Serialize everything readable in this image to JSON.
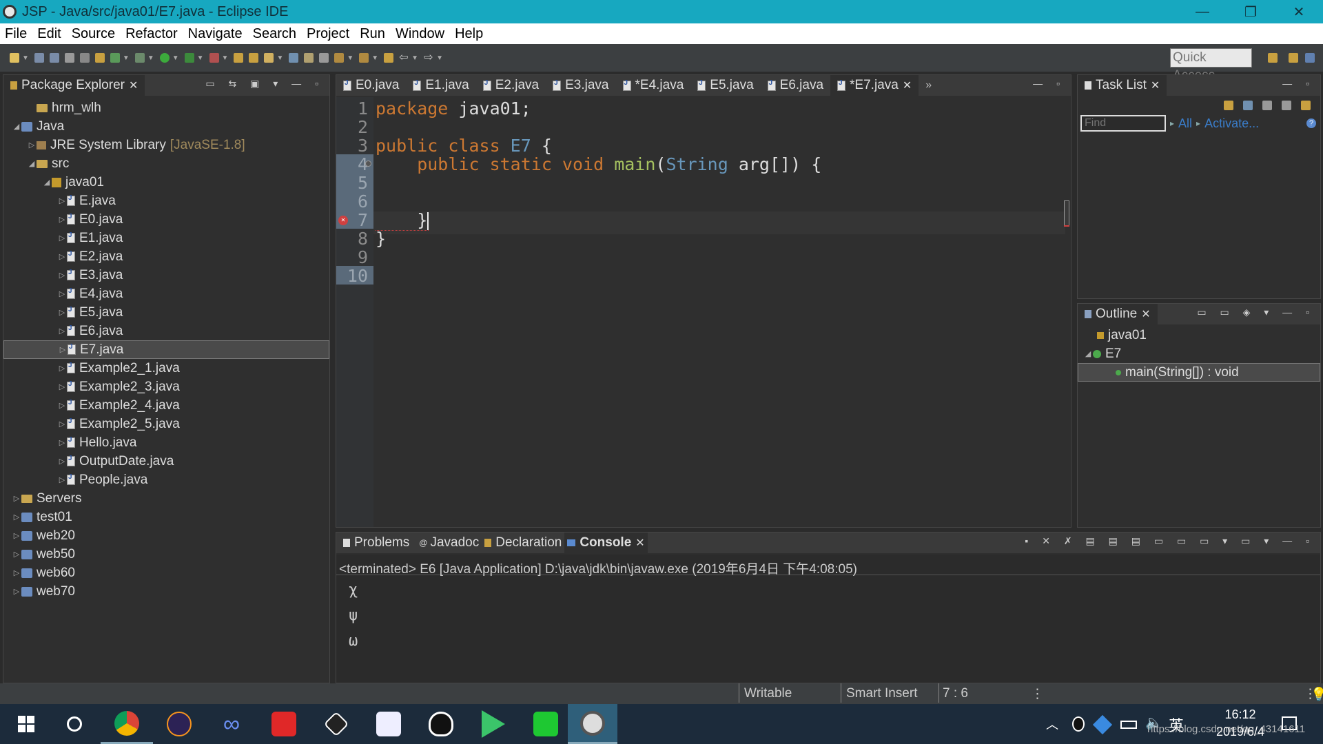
{
  "window": {
    "title": "JSP - Java/src/java01/E7.java - Eclipse IDE"
  },
  "menu": [
    "File",
    "Edit",
    "Source",
    "Refactor",
    "Navigate",
    "Search",
    "Project",
    "Run",
    "Window",
    "Help"
  ],
  "quick_access": "Quick Access",
  "package_explorer": {
    "title": "Package Explorer",
    "items": [
      {
        "label": "hrm_wlh",
        "level": 1,
        "kind": "folder",
        "arrow": ""
      },
      {
        "label": "Java",
        "level": 0,
        "kind": "project",
        "arrow": "◢"
      },
      {
        "label": "JRE System Library",
        "level": 1,
        "kind": "lib",
        "arrow": "▷",
        "extra": "[JavaSE-1.8]"
      },
      {
        "label": "src",
        "level": 1,
        "kind": "folder",
        "arrow": "◢"
      },
      {
        "label": "java01",
        "level": 2,
        "kind": "package",
        "arrow": "◢"
      },
      {
        "label": "E.java",
        "level": 3,
        "kind": "file",
        "arrow": "▷"
      },
      {
        "label": "E0.java",
        "level": 3,
        "kind": "file",
        "arrow": "▷"
      },
      {
        "label": "E1.java",
        "level": 3,
        "kind": "file",
        "arrow": "▷"
      },
      {
        "label": "E2.java",
        "level": 3,
        "kind": "file",
        "arrow": "▷"
      },
      {
        "label": "E3.java",
        "level": 3,
        "kind": "file",
        "arrow": "▷"
      },
      {
        "label": "E4.java",
        "level": 3,
        "kind": "file",
        "arrow": "▷"
      },
      {
        "label": "E5.java",
        "level": 3,
        "kind": "file",
        "arrow": "▷"
      },
      {
        "label": "E6.java",
        "level": 3,
        "kind": "file",
        "arrow": "▷"
      },
      {
        "label": "E7.java",
        "level": 3,
        "kind": "file",
        "arrow": "▷",
        "selected": true
      },
      {
        "label": "Example2_1.java",
        "level": 3,
        "kind": "file",
        "arrow": "▷"
      },
      {
        "label": "Example2_3.java",
        "level": 3,
        "kind": "file",
        "arrow": "▷"
      },
      {
        "label": "Example2_4.java",
        "level": 3,
        "kind": "file",
        "arrow": "▷"
      },
      {
        "label": "Example2_5.java",
        "level": 3,
        "kind": "file",
        "arrow": "▷"
      },
      {
        "label": "Hello.java",
        "level": 3,
        "kind": "file",
        "arrow": "▷"
      },
      {
        "label": "OutputDate.java",
        "level": 3,
        "kind": "file",
        "arrow": "▷"
      },
      {
        "label": "People.java",
        "level": 3,
        "kind": "file",
        "arrow": "▷"
      },
      {
        "label": "Servers",
        "level": 0,
        "kind": "folder",
        "arrow": "▷"
      },
      {
        "label": "test01",
        "level": 0,
        "kind": "project",
        "arrow": "▷"
      },
      {
        "label": "web20",
        "level": 0,
        "kind": "project",
        "arrow": "▷"
      },
      {
        "label": "web50",
        "level": 0,
        "kind": "project",
        "arrow": "▷"
      },
      {
        "label": "web60",
        "level": 0,
        "kind": "project",
        "arrow": "▷"
      },
      {
        "label": "web70",
        "level": 0,
        "kind": "project",
        "arrow": "▷"
      }
    ]
  },
  "editor_tabs": [
    "E0.java",
    "E1.java",
    "E2.java",
    "E3.java",
    "*E4.java",
    "E5.java",
    "E6.java",
    "*E7.java"
  ],
  "editor_overflow": "»",
  "code": {
    "line_numbers": [
      "1",
      "2",
      "3",
      "4",
      "5",
      "6",
      "7",
      "8",
      "9",
      "10"
    ],
    "l1_kw": "package",
    "l1_rest": " java01;",
    "l3_kw": "public class",
    "l3_cls": " E7",
    "l3_rest": " {",
    "l4_kw": "    public static void",
    "l4_fn": " main",
    "l4_p1": "(",
    "l4_ty": "String",
    "l4_rest": " arg[]) {",
    "l7": "    }",
    "l8": "}"
  },
  "task_list": {
    "title": "Task List",
    "find_placeholder": "Find",
    "all": "All",
    "activate": "Activate..."
  },
  "outline": {
    "title": "Outline",
    "items": [
      "java01",
      "E7",
      "main(String[]) : void"
    ]
  },
  "bottom_tabs": [
    "Problems",
    "Javadoc",
    "Declaration",
    "Console"
  ],
  "console": {
    "header": "<terminated> E6 [Java Application] D:\\java\\jdk\\bin\\javaw.exe (2019年6月4日 下午4:08:05)",
    "lines": [
      "χ",
      "ψ",
      "ω"
    ]
  },
  "status": {
    "writable": "Writable",
    "insert": "Smart Insert",
    "pos": "7 : 6"
  },
  "taskbar": {
    "time": "16:12",
    "date": "2019/6/4",
    "ime": "英",
    "watermark": "https://blog.csdn.net/qq_43141611"
  }
}
